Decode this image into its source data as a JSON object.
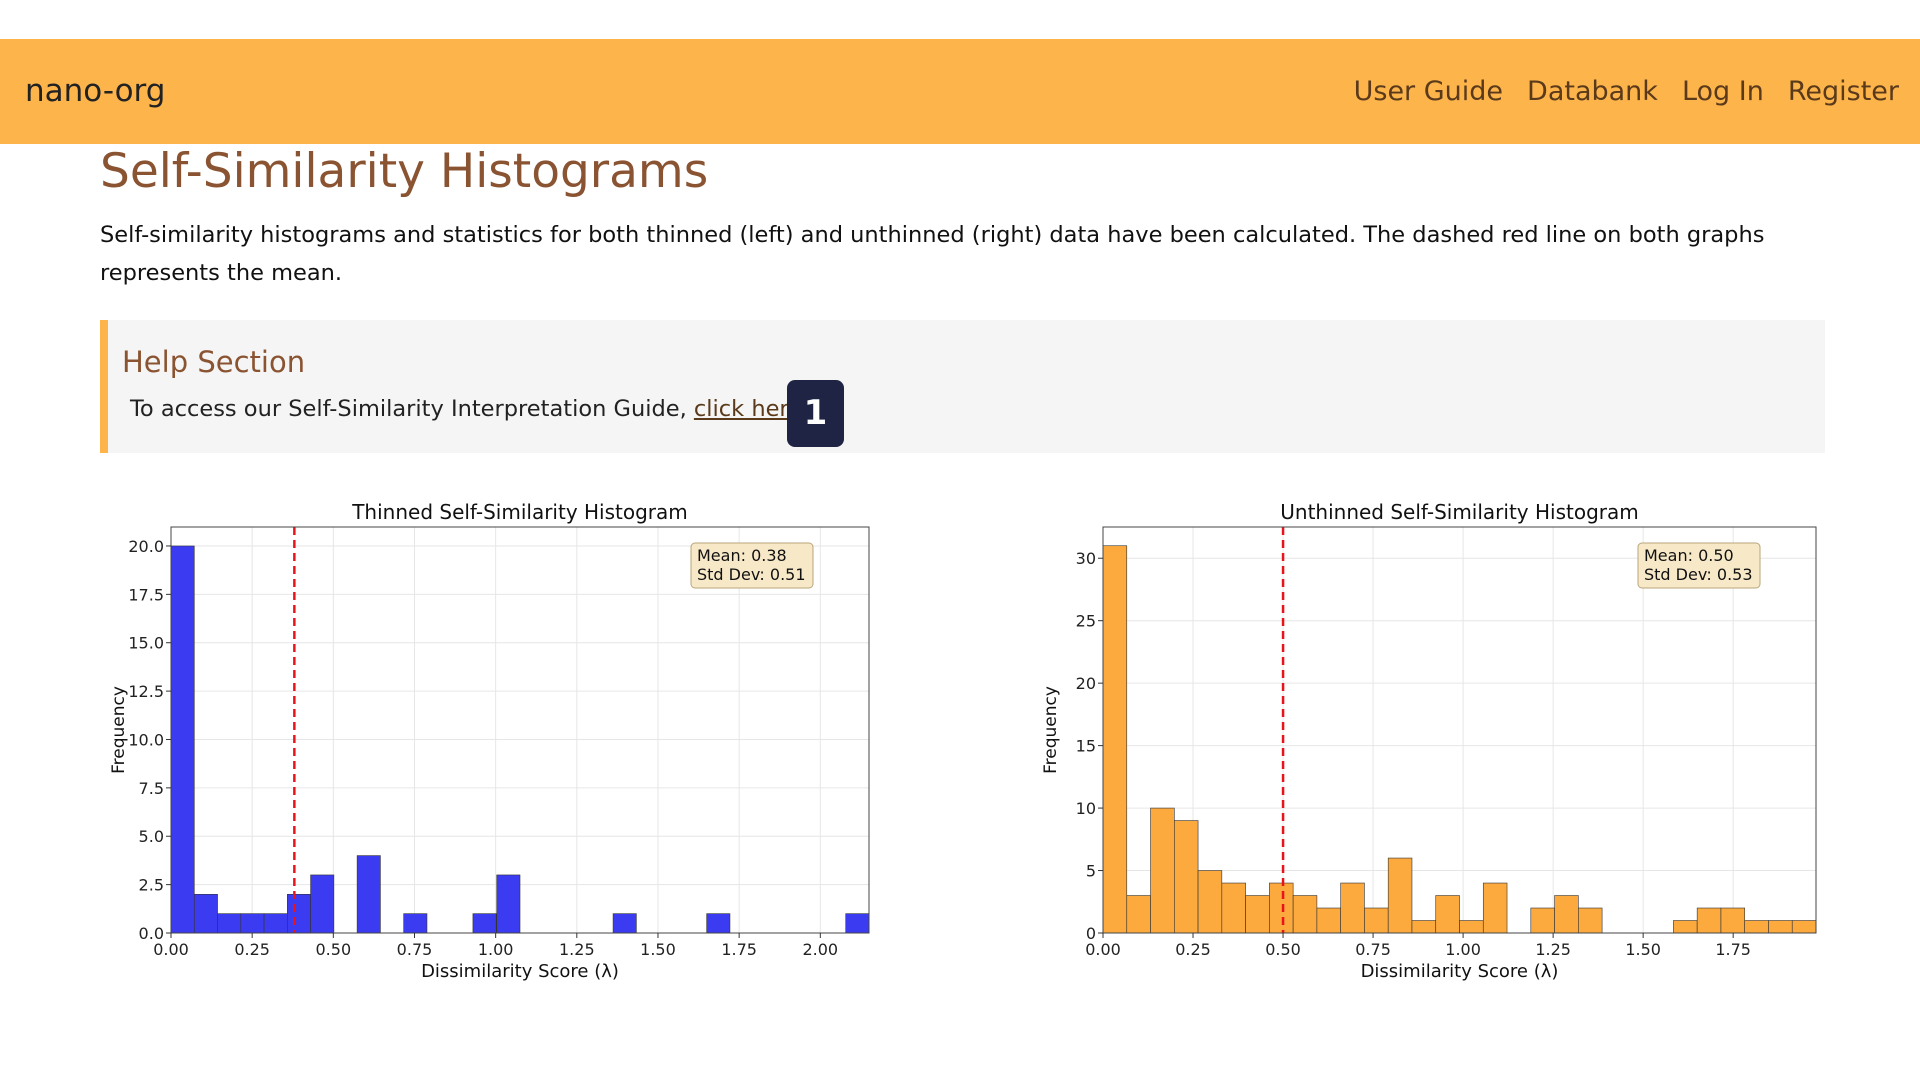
{
  "nav": {
    "brand": "nano-org",
    "links": [
      "User Guide",
      "Databank",
      "Log In",
      "Register"
    ]
  },
  "page": {
    "title": "Self-Similarity Histograms",
    "intro": "Self-similarity histograms and statistics for both thinned (left) and unthinned (right) data have been calculated. The dashed red line on both graphs represents the mean."
  },
  "help": {
    "title": "Help Section",
    "text": "To access our Self-Similarity  Interpretation Guide, ",
    "link_text": "click here.",
    "badge": "1"
  },
  "colors": {
    "navbar": "#fdb44b",
    "accent_text": "#8a5432",
    "thinned_bars": "#3b3bf2",
    "unthinned_bars": "#fca93e",
    "mean_line": "#e8141c"
  },
  "chart_data": [
    {
      "type": "bar",
      "title": "Thinned Self-Similarity Histogram",
      "xlabel": "Dissimilarity Score (λ)",
      "ylabel": "Frequency",
      "xlim": [
        0,
        2.15
      ],
      "ylim": [
        0,
        20.98
      ],
      "bin_width": 0.0717,
      "bins_start": [
        0,
        0.0717,
        0.1433,
        0.215,
        0.2867,
        0.3583,
        0.43,
        0.5733,
        0.7167,
        0.93,
        1.0033,
        1.3617,
        1.65,
        2.0783
      ],
      "values": [
        20,
        2,
        1,
        1,
        1,
        2,
        3,
        4,
        1,
        1,
        3,
        1,
        1,
        1
      ],
      "xticks": [
        "0.00",
        "0.25",
        "0.50",
        "0.75",
        "1.00",
        "1.25",
        "1.50",
        "1.75",
        "2.00"
      ],
      "xtick_values": [
        0,
        0.25,
        0.5,
        0.75,
        1.0,
        1.25,
        1.5,
        1.75,
        2.0
      ],
      "yticks": [
        "0.0",
        "2.5",
        "5.0",
        "7.5",
        "10.0",
        "12.5",
        "15.0",
        "17.5",
        "20.0"
      ],
      "ytick_values": [
        0,
        2.5,
        5,
        7.5,
        10,
        12.5,
        15,
        17.5,
        20
      ],
      "mean": 0.38,
      "stats_box": [
        "Mean: 0.38",
        "Std Dev: 0.51"
      ],
      "legend_position": "top-right",
      "grid": true
    },
    {
      "type": "bar",
      "title": "Unthinned Self-Similarity Histogram",
      "xlabel": "Dissimilarity Score (λ)",
      "ylabel": "Frequency",
      "xlim": [
        0,
        1.98
      ],
      "ylim": [
        0,
        32.5
      ],
      "bin_width": 0.066,
      "bins_start": [
        0,
        0.066,
        0.132,
        0.198,
        0.264,
        0.33,
        0.396,
        0.462,
        0.528,
        0.594,
        0.66,
        0.726,
        0.792,
        0.858,
        0.924,
        0.99,
        1.056,
        1.122,
        1.188,
        1.254,
        1.32,
        1.386,
        1.452,
        1.518,
        1.584,
        1.65,
        1.716,
        1.782,
        1.848,
        1.914
      ],
      "values": [
        31,
        3,
        10,
        9,
        5,
        4,
        3,
        4,
        3,
        2,
        4,
        2,
        6,
        1,
        3,
        1,
        4,
        0,
        2,
        3,
        2,
        0,
        0,
        0,
        1,
        2,
        2,
        1,
        1,
        1
      ],
      "xticks": [
        "0.00",
        "0.25",
        "0.50",
        "0.75",
        "1.00",
        "1.25",
        "1.50",
        "1.75"
      ],
      "xtick_values": [
        0,
        0.25,
        0.5,
        0.75,
        1.0,
        1.25,
        1.5,
        1.75
      ],
      "yticks": [
        "0",
        "5",
        "10",
        "15",
        "20",
        "25",
        "30"
      ],
      "ytick_values": [
        0,
        5,
        10,
        15,
        20,
        25,
        30
      ],
      "mean": 0.5,
      "stats_box": [
        "Mean: 0.50",
        "Std Dev: 0.53"
      ],
      "legend_position": "top-right",
      "grid": true
    }
  ]
}
